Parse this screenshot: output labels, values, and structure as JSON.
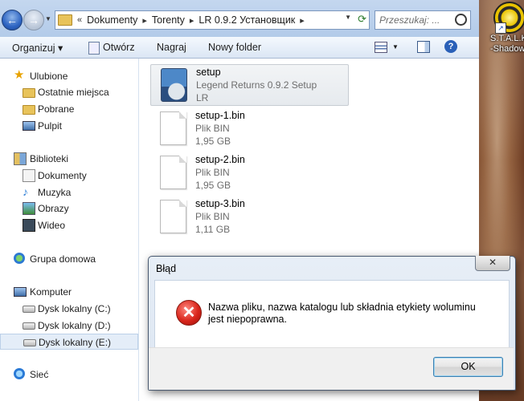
{
  "window": {
    "breadcrumb": [
      "Dokumenty",
      "Torenty",
      "LR 0.9.2 Установщик"
    ],
    "overflow_chevron": "«",
    "search_placeholder": "Przeszukaj: ..."
  },
  "toolbar": {
    "organize": "Organizuj ▾",
    "open": "Otwórz",
    "burn": "Nagraj",
    "new_folder": "Nowy folder"
  },
  "navpane": {
    "favorites": "Ulubione",
    "recent": "Ostatnie miejsca",
    "downloads": "Pobrane",
    "desktop": "Pulpit",
    "libraries": "Biblioteki",
    "documents": "Dokumenty",
    "music": "Muzyka",
    "pictures": "Obrazy",
    "videos": "Wideo",
    "homegroup": "Grupa domowa",
    "computer": "Komputer",
    "drive_c": "Dysk lokalny (C:)",
    "drive_d": "Dysk lokalny (D:)",
    "drive_e": "Dysk lokalny (E:)",
    "network": "Sieć"
  },
  "files": [
    {
      "name": "setup",
      "line2": "Legend Returns 0.9.2 Setup",
      "line3": "LR"
    },
    {
      "name": "setup-1.bin",
      "line2": "Plik BIN",
      "line3": "1,95 GB"
    },
    {
      "name": "setup-2.bin",
      "line2": "Plik BIN",
      "line3": "1,95 GB"
    },
    {
      "name": "setup-3.bin",
      "line2": "Plik BIN",
      "line3": "1,11 GB"
    }
  ],
  "dialog": {
    "title": "Błąd",
    "close": "✕",
    "message": "Nazwa pliku, nazwa katalogu lub składnia etykiety woluminu jest niepoprawna.",
    "ok": "OK"
  },
  "desktop": {
    "icon_label_1": "S.T.A.L.K",
    "icon_label_2": "-Shadow o"
  },
  "colors": {
    "accent": "#3c7fb1",
    "error": "#d9261c",
    "selection": "#e4edf8"
  }
}
